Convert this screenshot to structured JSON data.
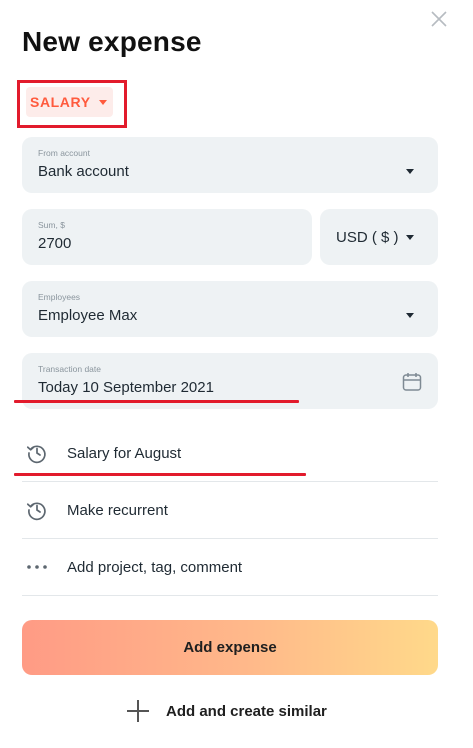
{
  "header": {
    "title": "New expense"
  },
  "category": {
    "label": "SALARY",
    "color": "#ff5a3d"
  },
  "from_account": {
    "label": "From account",
    "value": "Bank account"
  },
  "sum": {
    "label": "Sum, $",
    "value": "2700"
  },
  "currency": {
    "value": "USD ( $ )"
  },
  "employees": {
    "label": "Employees",
    "value": "Employee Max"
  },
  "transaction_date": {
    "label": "Transaction date",
    "value": "Today 10 September 2021"
  },
  "rows": [
    {
      "icon": "history-icon",
      "text": "Salary for August"
    },
    {
      "icon": "history-icon",
      "text": "Make recurrent"
    },
    {
      "icon": "more-dots-icon",
      "text": "Add project, tag, comment"
    }
  ],
  "actions": {
    "primary": "Add expense",
    "secondary": "Add and create similar"
  },
  "colors": {
    "annotation_red": "#e21b2c",
    "field_bg": "#eef2f4",
    "gradient_start": "#ff9b85",
    "gradient_end": "#ffd98a"
  }
}
